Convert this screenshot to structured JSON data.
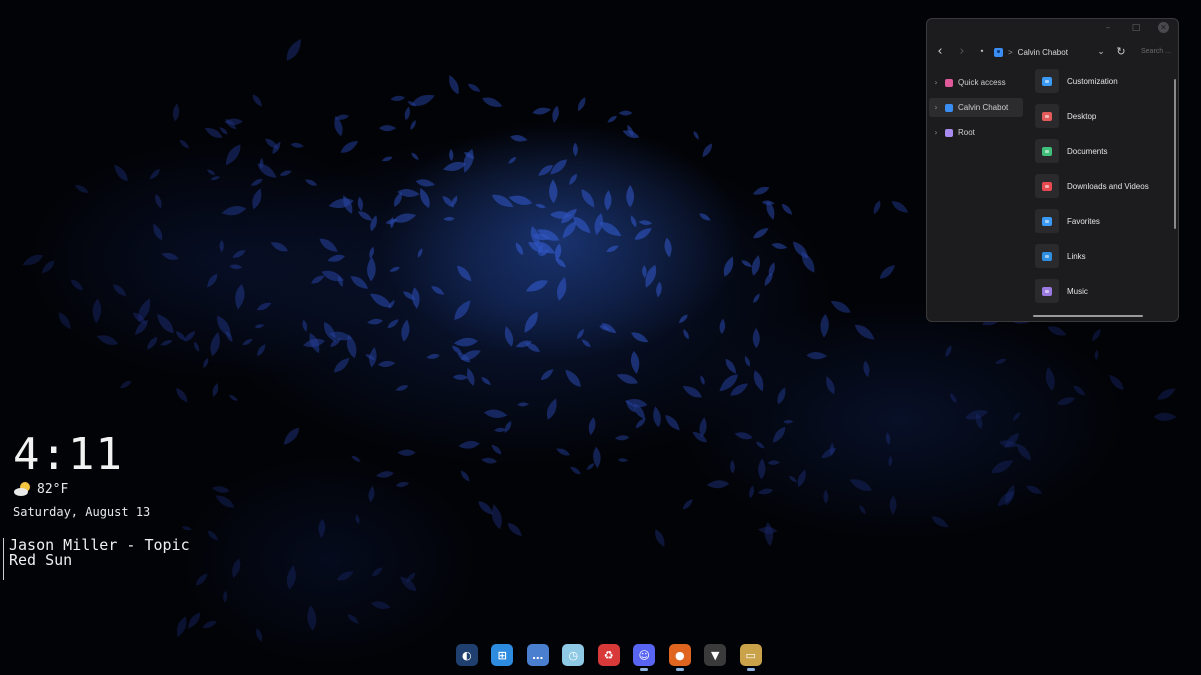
{
  "widgets": {
    "time": "4:11",
    "weather": {
      "icon": "partly-cloudy-icon",
      "temperature": "82°F"
    },
    "date": "Saturday, August 13",
    "media": {
      "artist_line": "Jason Miller - Topic",
      "track": "Red Sun"
    }
  },
  "explorer": {
    "controls": {
      "minimize": "–",
      "maximize": "□",
      "close": "✕"
    },
    "nav": {
      "back": "‹",
      "forward": "›",
      "dot": "•",
      "chevron": "⌄",
      "refresh": "↻"
    },
    "breadcrumb": {
      "separator": ">",
      "location": "Calvin Chabot"
    },
    "search_placeholder": "Search ...",
    "sidebar": [
      {
        "label": "Quick access",
        "color": "#e05a9b",
        "selected": false
      },
      {
        "label": "Calvin Chabot",
        "color": "#3a8df2",
        "selected": true
      },
      {
        "label": "Root",
        "color": "#a98af0",
        "selected": false
      }
    ],
    "folders": [
      {
        "name": "Customization",
        "color": "#3a9af5"
      },
      {
        "name": "Desktop",
        "color": "#e35a5a"
      },
      {
        "name": "Documents",
        "color": "#3fbf7a"
      },
      {
        "name": "Downloads and Videos",
        "color": "#e8484f"
      },
      {
        "name": "Favorites",
        "color": "#3a9af5"
      },
      {
        "name": "Links",
        "color": "#2e8fe0"
      },
      {
        "name": "Music",
        "color": "#9a7ae0"
      }
    ]
  },
  "dock": [
    {
      "name": "toggle-app-icon",
      "color": "#1f3f6e",
      "glyph": "◐",
      "running": false
    },
    {
      "name": "start-menu-icon",
      "color": "#2d8be0",
      "glyph": "⊞",
      "running": false
    },
    {
      "name": "more-apps-icon",
      "color": "#4a7fd0",
      "glyph": "…",
      "running": false
    },
    {
      "name": "clock-app-icon",
      "color": "#8ec9e6",
      "glyph": "◷",
      "running": false
    },
    {
      "name": "recycle-icon",
      "color": "#d83a3a",
      "glyph": "♻",
      "running": false
    },
    {
      "name": "discord-icon",
      "color": "#5865f2",
      "glyph": "☺",
      "running": true
    },
    {
      "name": "firefox-icon",
      "color": "#e0661f",
      "glyph": "●",
      "running": true
    },
    {
      "name": "wolf-app-icon",
      "color": "#3a3a3a",
      "glyph": "▼",
      "running": false
    },
    {
      "name": "file-explorer-icon",
      "color": "#c9a24a",
      "glyph": "▭",
      "running": true
    }
  ]
}
